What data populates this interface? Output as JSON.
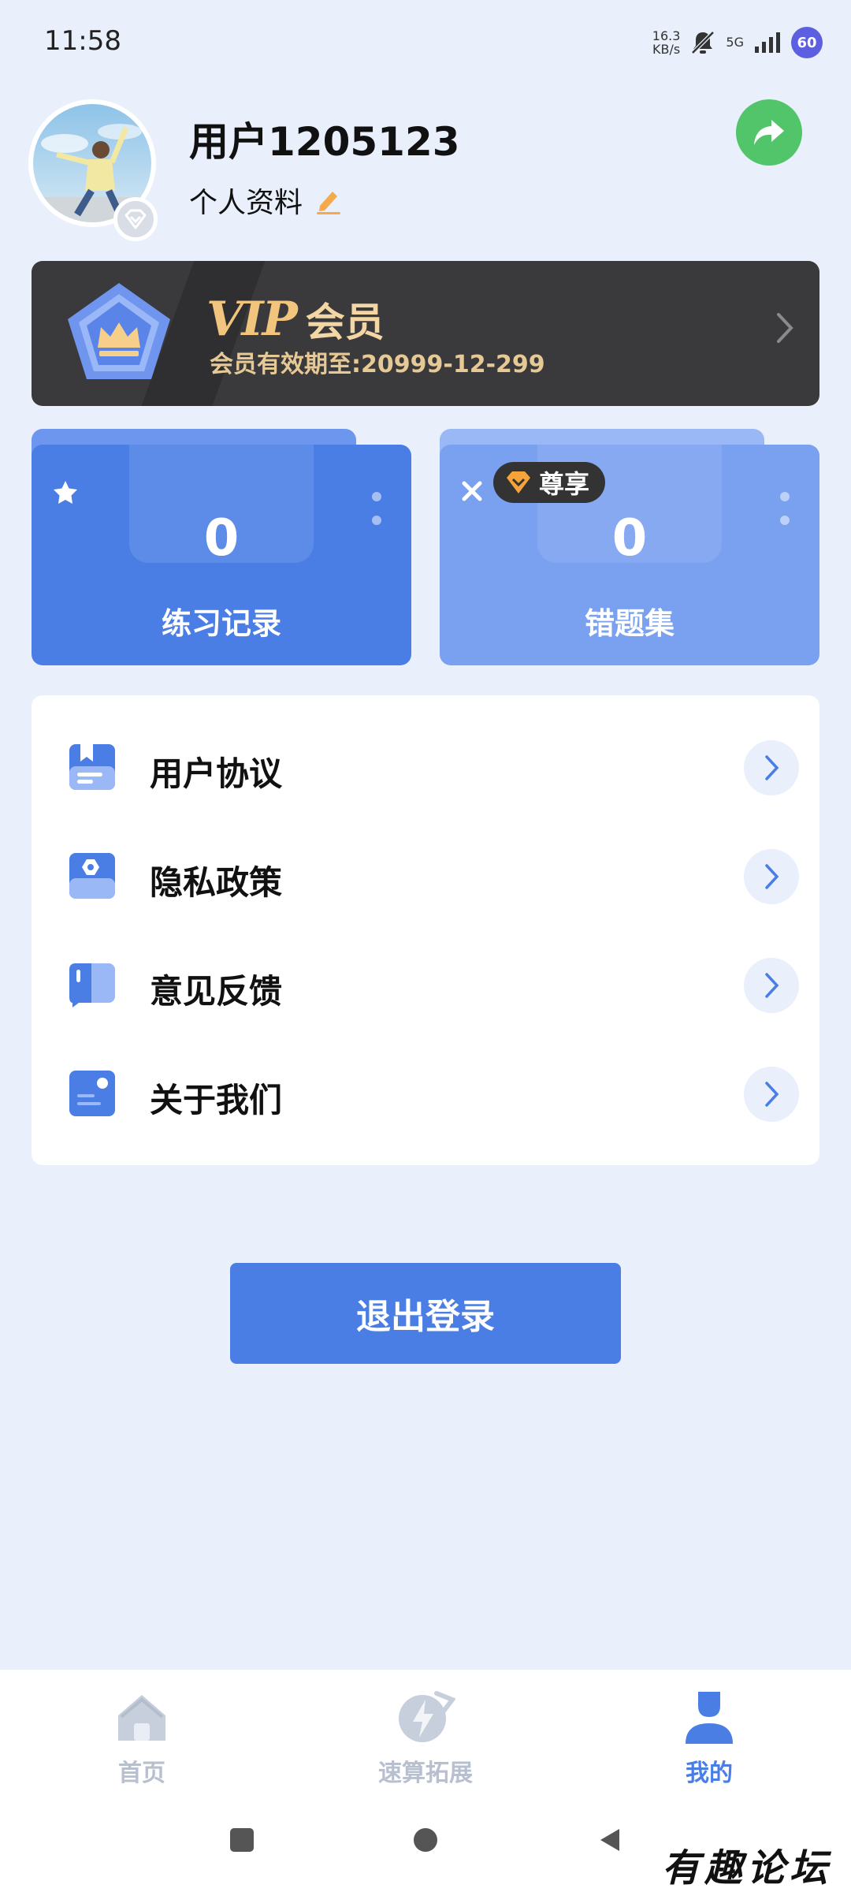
{
  "status_bar": {
    "time": "11:58",
    "net_speed_value": "16.3",
    "net_speed_unit": "KB/s",
    "network": "5G",
    "battery": "60"
  },
  "profile": {
    "username": "用户1205123",
    "profile_link": "个人资料"
  },
  "vip": {
    "logo": "VIP",
    "label": "会员",
    "expiry": "会员有效期至:20999-12-299",
    "accent_color": "#f1c57e"
  },
  "stats": {
    "practice": {
      "count": "0",
      "label": "练习记录"
    },
    "mistakes": {
      "count": "0",
      "label": "错题集",
      "badge": "尊享"
    }
  },
  "menu": [
    {
      "label": "用户协议",
      "icon": "agreement-icon"
    },
    {
      "label": "隐私政策",
      "icon": "privacy-icon"
    },
    {
      "label": "意见反馈",
      "icon": "feedback-icon"
    },
    {
      "label": "关于我们",
      "icon": "about-icon"
    }
  ],
  "logout_label": "退出登录",
  "bottom_nav": [
    {
      "label": "首页",
      "icon": "home-icon",
      "active": false
    },
    {
      "label": "速算拓展",
      "icon": "lightning-icon",
      "active": false
    },
    {
      "label": "我的",
      "icon": "person-icon",
      "active": true
    }
  ],
  "watermark": "有趣论坛",
  "colors": {
    "primary": "#4a7ee5",
    "background": "#e9f0fc",
    "share": "#52c56a",
    "vip_card": "#3a3a3c"
  }
}
